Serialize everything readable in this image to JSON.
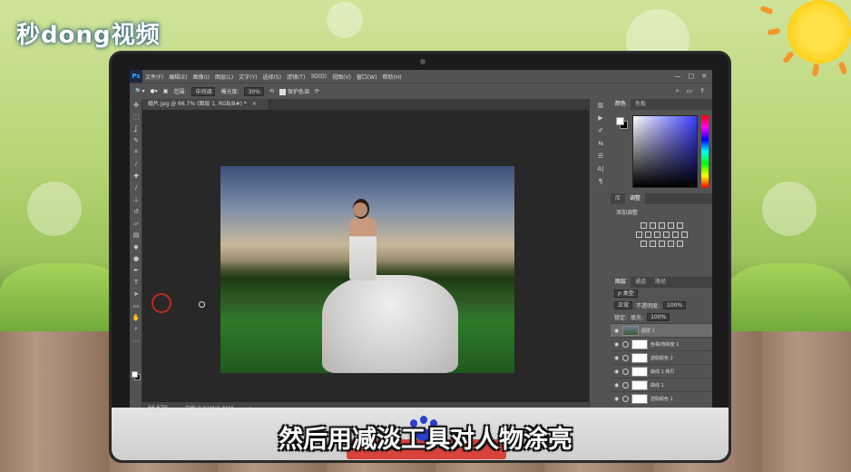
{
  "branding": {
    "logo_text": "秒dong视频"
  },
  "caption": "然后用减淡工具对人物涂亮",
  "photoshop": {
    "menu": [
      "文件(F)",
      "编辑(E)",
      "图像(I)",
      "图层(L)",
      "文字(Y)",
      "选择(S)",
      "滤镜(T)",
      "3D(D)",
      "视图(V)",
      "窗口(W)",
      "帮助(H)"
    ],
    "window_controls": [
      "—",
      "□",
      "✕"
    ],
    "options": {
      "range_label": "范围:",
      "range_value": "中间调",
      "exposure_label": "曝光度:",
      "exposure_value": "30%",
      "protect_tones": "保护色调"
    },
    "document_tab": "婚片.jpg @ 66.7% (图层 1, RGB/8#) *",
    "status": {
      "zoom": "66.67%",
      "doc_size": "文档:2.91M/4.01M"
    },
    "color_panel": {
      "tabs": [
        "颜色",
        "色板"
      ]
    },
    "adjust_panel": {
      "tabs": [
        "库",
        "调整"
      ],
      "add_label": "添加调整"
    },
    "layers_panel": {
      "tabs": [
        "图层",
        "通道",
        "路径"
      ],
      "kind": "ρ 类型",
      "blend_mode": "正常",
      "opacity_label": "不透明度:",
      "opacity_value": "100%",
      "lock_label": "锁定:",
      "fill_label": "填充:",
      "fill_value": "100%",
      "layers": [
        {
          "name": "图层 1",
          "selected": true
        },
        {
          "name": "色相/饱和度 1",
          "selected": false
        },
        {
          "name": "选取颜色 2",
          "selected": false
        },
        {
          "name": "曲线 1 拷贝",
          "selected": false
        },
        {
          "name": "曲线 1",
          "selected": false
        },
        {
          "name": "选取颜色 1",
          "selected": false
        }
      ]
    }
  },
  "accent": {
    "brush_circle": "#c0281c",
    "caption_outline": "#111111"
  }
}
